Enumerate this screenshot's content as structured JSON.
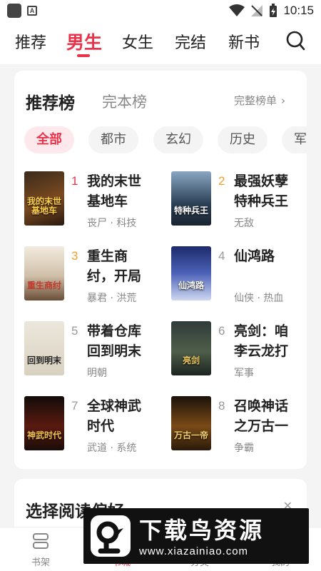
{
  "status_bar": {
    "time": "10:15"
  },
  "top_nav": {
    "tabs": [
      {
        "label": "推荐"
      },
      {
        "label": "男生"
      },
      {
        "label": "女生"
      },
      {
        "label": "完结"
      },
      {
        "label": "新书"
      }
    ],
    "active_tab": "男生",
    "search_icon": "search-icon"
  },
  "ranking": {
    "tabs": [
      {
        "label": "推荐榜"
      },
      {
        "label": "完本榜"
      }
    ],
    "full_list_label": "完整榜单",
    "chips": [
      {
        "label": "全部"
      },
      {
        "label": "都市"
      },
      {
        "label": "玄幻"
      },
      {
        "label": "历史"
      },
      {
        "label": "军"
      }
    ],
    "books": [
      {
        "rank": "1",
        "title": "我的末世基地车",
        "tags": "丧尸 · 科技",
        "cover_text": "我的末世基地车"
      },
      {
        "rank": "2",
        "title": "最强妖孽特种兵王",
        "tags": "无敌",
        "cover_text": "特种兵王"
      },
      {
        "rank": "3",
        "title": "重生商纣，开局",
        "tags": "暴君 · 洪荒",
        "cover_text": "重生商纣"
      },
      {
        "rank": "4",
        "title": "仙鸿路",
        "tags": "仙侠 · 热血",
        "cover_text": "仙鸿路"
      },
      {
        "rank": "5",
        "title": "带着仓库回到明末",
        "tags": "明朝",
        "cover_text": "回到明末"
      },
      {
        "rank": "6",
        "title": "亮剑：咱李云龙打",
        "tags": "军事",
        "cover_text": "亮剑"
      },
      {
        "rank": "7",
        "title": "全球神武时代",
        "tags": "武道 · 系统",
        "cover_text": "神武时代"
      },
      {
        "rank": "8",
        "title": "召唤神话之万古一",
        "tags": "争霸",
        "cover_text": "万古一帝"
      }
    ]
  },
  "preference": {
    "title": "选择阅读偏好",
    "close_icon": "close-icon"
  },
  "bottom_nav": {
    "items": [
      {
        "label": "书架"
      },
      {
        "label": "书城"
      },
      {
        "label": "分类"
      },
      {
        "label": "我的"
      }
    ]
  },
  "watermark": {
    "title": "下载鸟资源",
    "url": "www.xiazainiao.com"
  },
  "colors": {
    "accent": "#e8334a",
    "rank_gold": "#f0a030",
    "background": "#f4f4f4"
  }
}
